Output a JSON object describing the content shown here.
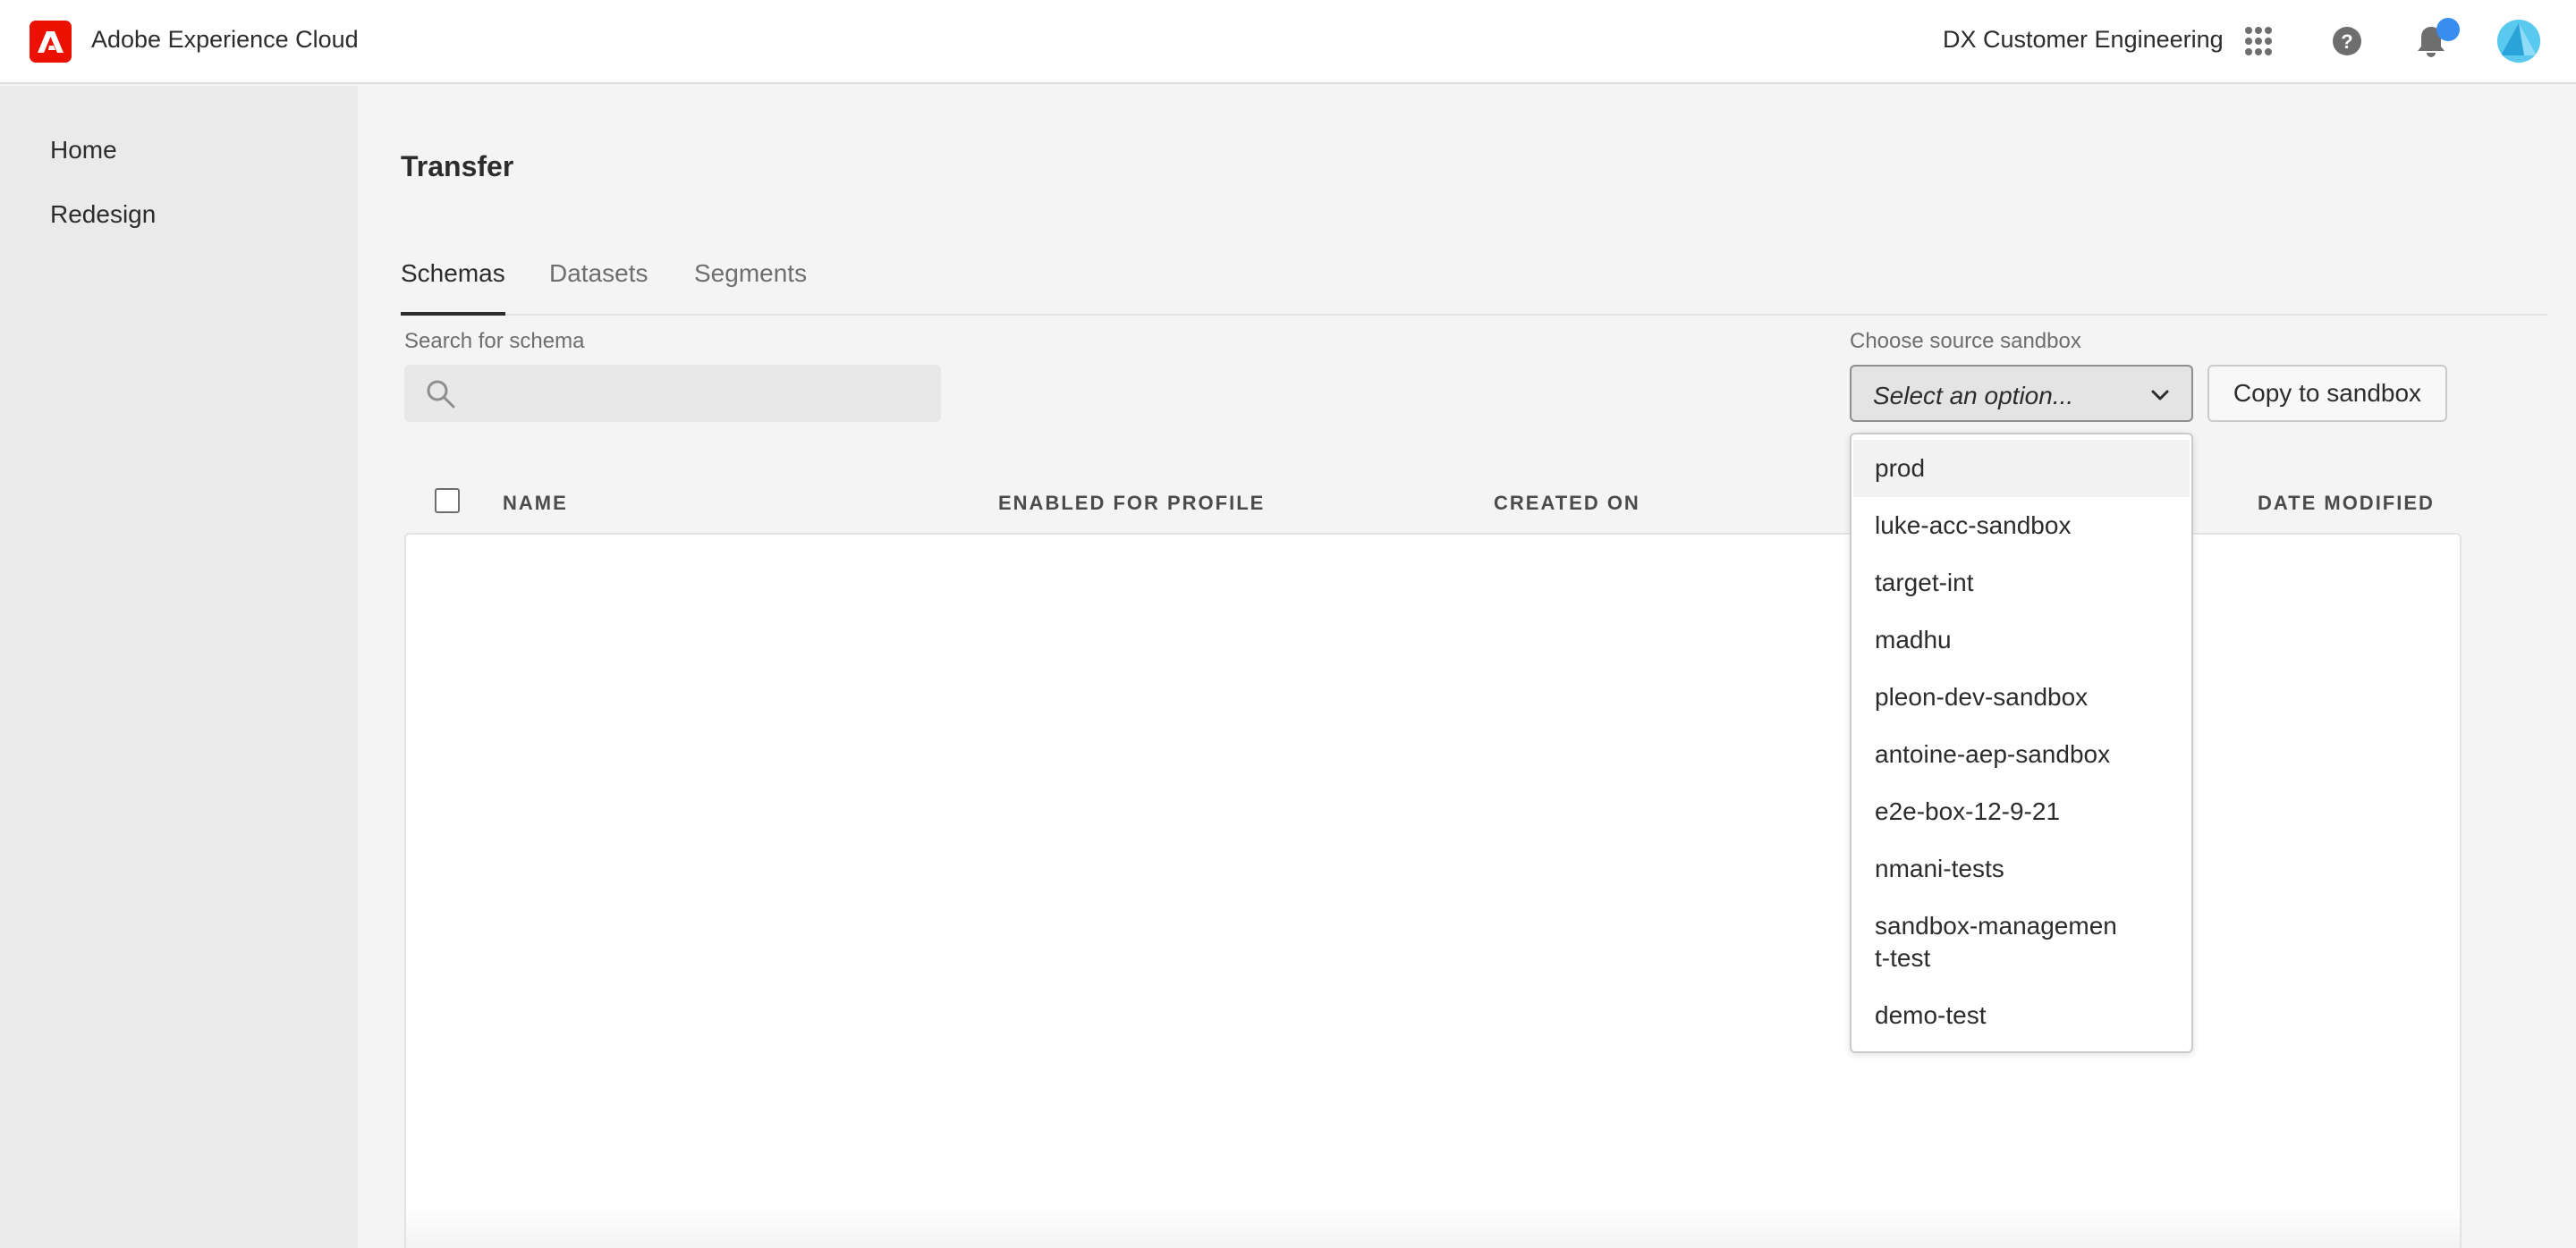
{
  "header": {
    "app_title": "Adobe Experience Cloud",
    "org_name": "DX Customer Engineering",
    "brand_color": "#eb1000",
    "icons": [
      "adobe-logo",
      "apps-grid-icon",
      "help-icon",
      "bell-icon",
      "avatar"
    ]
  },
  "nav": {
    "items": [
      {
        "label": "Home"
      },
      {
        "label": "Redesign"
      }
    ]
  },
  "page": {
    "title": "Transfer",
    "tabs": [
      {
        "label": "Schemas",
        "selected": true
      },
      {
        "label": "Datasets",
        "selected": false
      },
      {
        "label": "Segments",
        "selected": false
      }
    ]
  },
  "search": {
    "label": "Search for schema",
    "value": "",
    "placeholder": ""
  },
  "sandbox": {
    "label": "Choose source sandbox",
    "placeholder": "Select an option...",
    "copy_button": "Copy to sandbox",
    "options": [
      "prod",
      "luke-acc-sandbox",
      "target-int",
      "madhu",
      "pleon-dev-sandbox",
      "antoine-aep-sandbox",
      "e2e-box-12-9-21",
      "nmani-tests",
      "sandbox-management-test",
      "demo-test"
    ],
    "highlighted": "prod"
  },
  "table": {
    "columns": [
      "NAME",
      "ENABLED FOR PROFILE",
      "CREATED ON",
      "DATE MODIFIED"
    ],
    "rows": []
  }
}
